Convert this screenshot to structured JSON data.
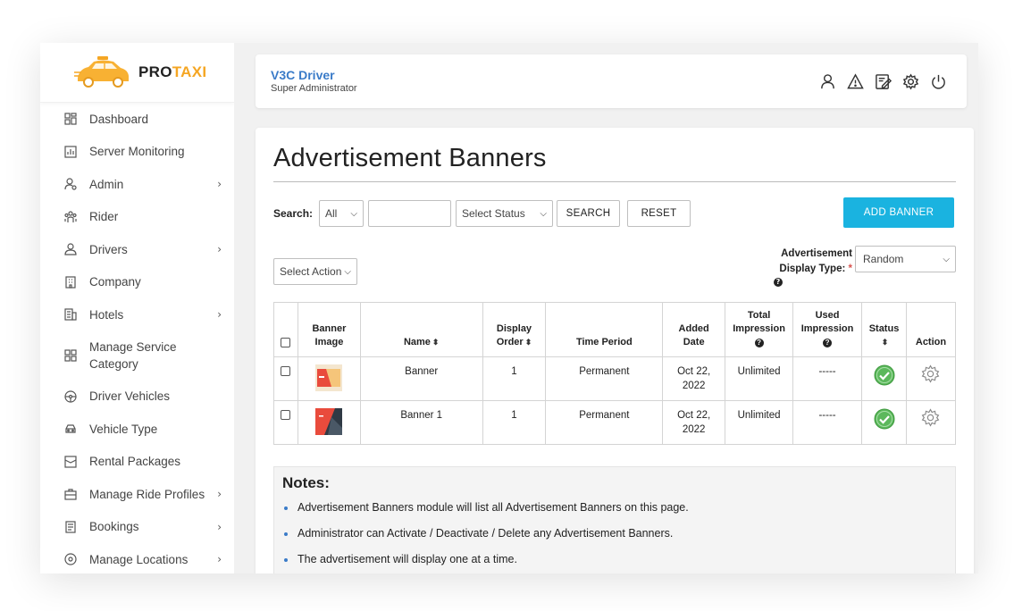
{
  "brand": {
    "pro": "PRO",
    "taxi": "TAXI"
  },
  "sidebar": {
    "items": [
      {
        "label": "Dashboard",
        "icon": "dashboard-icon",
        "has_sub": false
      },
      {
        "label": "Server Monitoring",
        "icon": "chart-icon",
        "has_sub": false
      },
      {
        "label": "Admin",
        "icon": "user-gear-icon",
        "has_sub": true
      },
      {
        "label": "Rider",
        "icon": "rider-icon",
        "has_sub": false
      },
      {
        "label": "Drivers",
        "icon": "driver-icon",
        "has_sub": true
      },
      {
        "label": "Company",
        "icon": "building-icon",
        "has_sub": false
      },
      {
        "label": "Hotels",
        "icon": "hotel-icon",
        "has_sub": true
      },
      {
        "label": "Manage Service Category",
        "icon": "grid-icon",
        "has_sub": false
      },
      {
        "label": "Driver Vehicles",
        "icon": "steering-wheel-icon",
        "has_sub": false
      },
      {
        "label": "Vehicle Type",
        "icon": "car-icon",
        "has_sub": false
      },
      {
        "label": "Rental Packages",
        "icon": "package-icon",
        "has_sub": false
      },
      {
        "label": "Manage Ride Profiles",
        "icon": "briefcase-icon",
        "has_sub": true
      },
      {
        "label": "Bookings",
        "icon": "bookings-icon",
        "has_sub": true
      },
      {
        "label": "Manage Locations",
        "icon": "location-icon",
        "has_sub": true
      }
    ]
  },
  "header": {
    "title": "V3C Driver",
    "subtitle": "Super Administrator",
    "icons": [
      "user-icon",
      "warning-icon",
      "edit-icon",
      "gear-icon",
      "power-icon"
    ]
  },
  "page": {
    "title": "Advertisement Banners",
    "search": {
      "label": "Search:",
      "field_option": "All",
      "keyword_value": "",
      "status_placeholder": "Select Status",
      "search_button": "SEARCH",
      "reset_button": "RESET"
    },
    "add_button": "ADD BANNER",
    "select_action": "Select Action",
    "display_type": {
      "label_line1": "Advertisement",
      "label_line2": "Display Type:",
      "required": "*",
      "value": "Random"
    }
  },
  "table": {
    "headers": {
      "banner_image_1": "Banner",
      "banner_image_2": "Image",
      "name": "Name",
      "display_order_1": "Display",
      "display_order_2": "Order",
      "time_period": "Time Period",
      "added_date_1": "Added",
      "added_date_2": "Date",
      "total_impression_1": "Total",
      "total_impression_2": "Impression",
      "used_impression_1": "Used",
      "used_impression_2": "Impression",
      "status": "Status",
      "action": "Action"
    },
    "rows": [
      {
        "name": "Banner",
        "display_order": "1",
        "time_period": "Permanent",
        "added_date_1": "Oct 22,",
        "added_date_2": "2022",
        "total_impression": "Unlimited",
        "used_impression": "-----"
      },
      {
        "name": "Banner 1",
        "display_order": "1",
        "time_period": "Permanent",
        "added_date_1": "Oct 22,",
        "added_date_2": "2022",
        "total_impression": "Unlimited",
        "used_impression": "-----"
      }
    ]
  },
  "notes": {
    "title": "Notes:",
    "items": [
      "Advertisement Banners module will list all Advertisement Banners on this page.",
      "Administrator can Activate / Deactivate / Delete any Advertisement Banners.",
      "The advertisement will display one at a time."
    ]
  },
  "colors": {
    "accent": "#1ab3e0",
    "brand_orange": "#f5a623",
    "status_green": "#5cb85c",
    "header_blue": "#3a7bc8"
  }
}
